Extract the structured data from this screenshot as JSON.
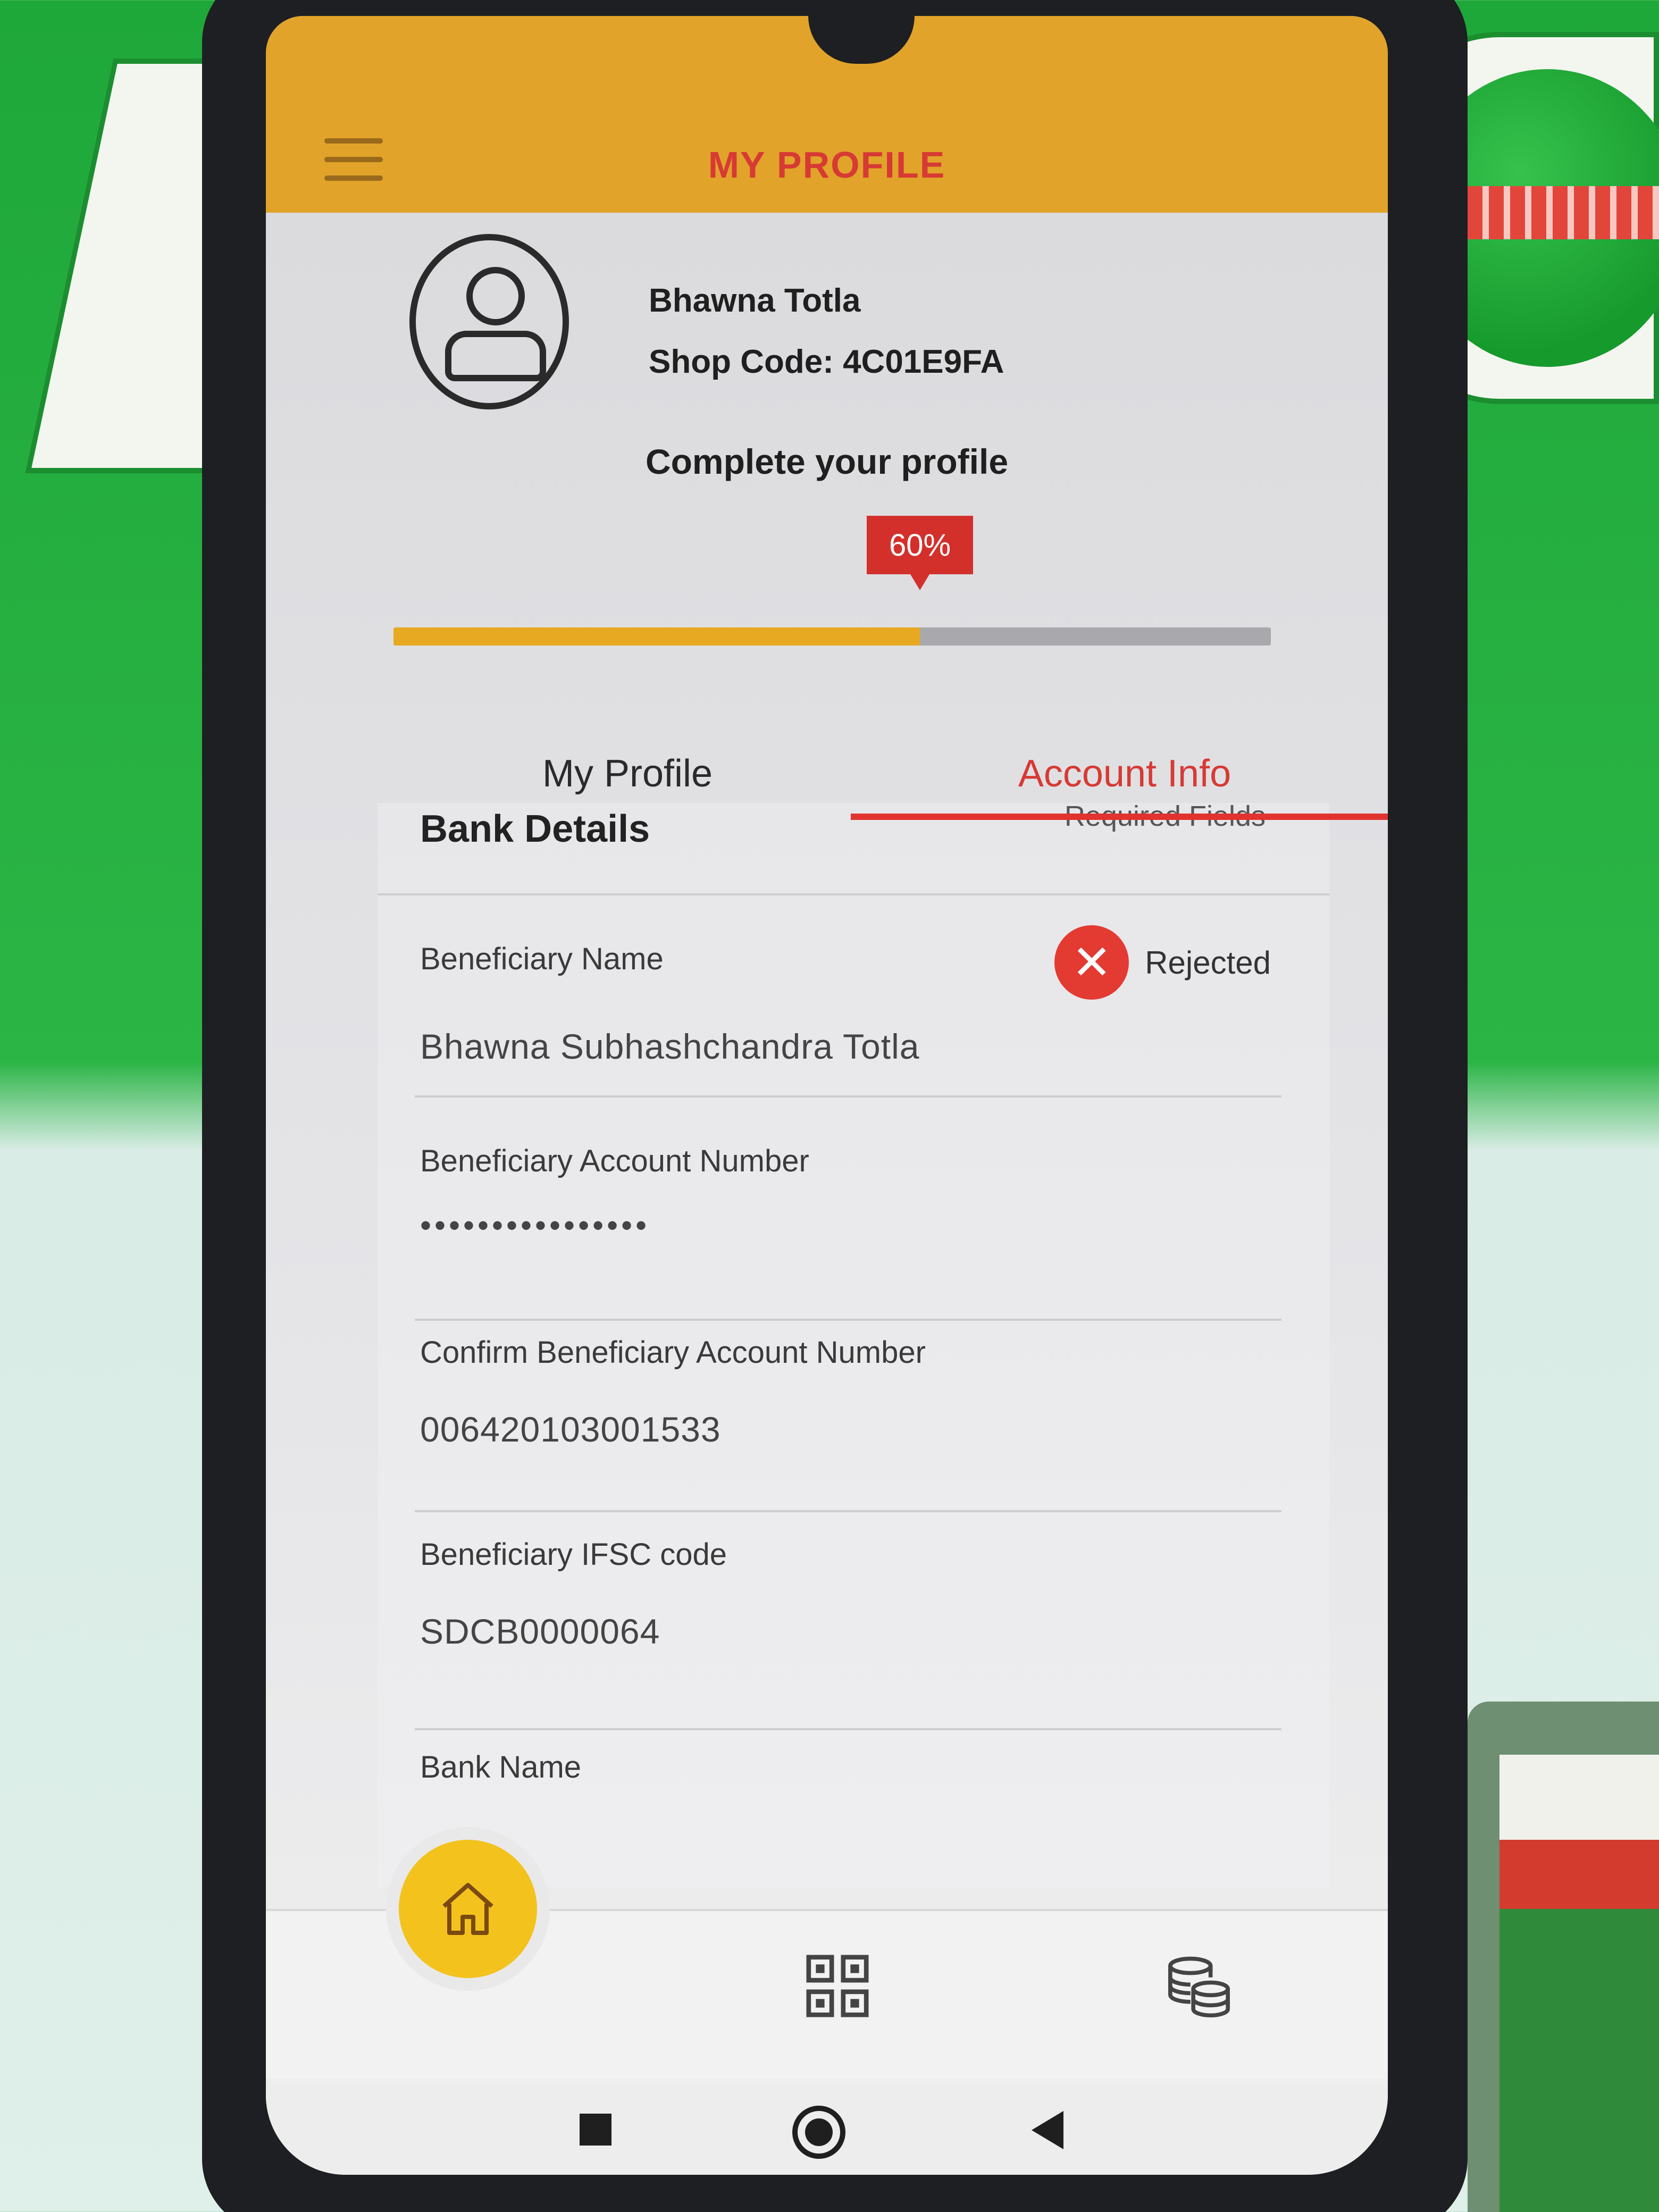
{
  "app": {
    "title": "MY PROFILE"
  },
  "profile": {
    "name": "Bhawna Totla",
    "shop_code": "Shop Code: 4C01E9FA",
    "complete_title": "Complete your profile",
    "completion_percent_label": "60%",
    "completion_fraction": 0.6
  },
  "tabs": [
    {
      "label": "My Profile",
      "active": false
    },
    {
      "label": "Account Info",
      "active": true
    }
  ],
  "bank": {
    "title": "Bank Details",
    "required_note": "Required Fields",
    "status": {
      "label": "Rejected",
      "icon": "close-icon",
      "color": "#e33a32"
    },
    "fields": [
      {
        "label": "Beneficiary Name",
        "value": "Bhawna Subhashchandra Totla"
      },
      {
        "label": "Beneficiary Account Number",
        "value": "••••••••••••••••"
      },
      {
        "label": "Confirm Beneficiary Account Number",
        "value": "006420103001533"
      },
      {
        "label": "Beneficiary IFSC code",
        "value": "SDCB0000064"
      },
      {
        "label": "Bank Name",
        "value": ""
      }
    ]
  },
  "bottom_nav": {
    "items": [
      {
        "name": "home",
        "icon": "home-icon"
      },
      {
        "name": "scan",
        "icon": "qr-code-icon"
      },
      {
        "name": "points",
        "icon": "coins-icon"
      }
    ]
  },
  "colors": {
    "accent_orange": "#e1a32a",
    "accent_red": "#d73a34",
    "progress_fill": "#e7a921",
    "home_yellow": "#f3c21d"
  }
}
